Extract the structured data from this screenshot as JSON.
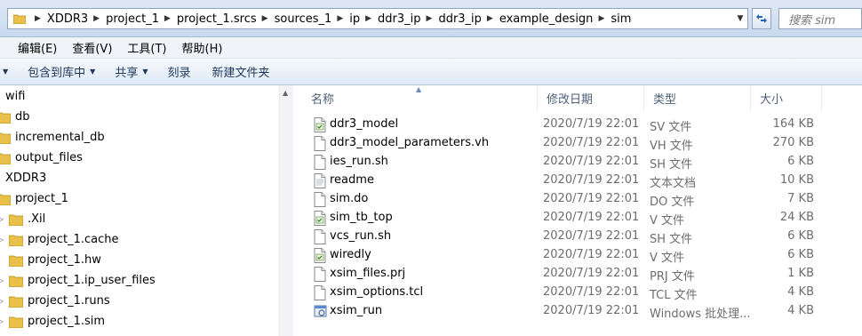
{
  "address": {
    "crumbs": [
      "XDDR3",
      "project_1",
      "project_1.srcs",
      "sources_1",
      "ip",
      "ddr3_ip",
      "ddr3_ip",
      "example_design",
      "sim"
    ],
    "search_placeholder": "搜索 sim"
  },
  "menu": {
    "items": [
      "编辑(E)",
      "查看(V)",
      "工具(T)",
      "帮助(H)"
    ]
  },
  "toolbar": {
    "include_library": "包含到库中",
    "share": "共享",
    "burn": "刻录",
    "new_folder": "新建文件夹"
  },
  "nav": {
    "items": [
      "wifi",
      "db",
      "incremental_db",
      "output_files",
      "XDDR3",
      "project_1",
      ".Xil",
      "project_1.cache",
      "project_1.hw",
      "project_1.ip_user_files",
      "project_1.runs",
      "project_1.sim"
    ]
  },
  "columns": {
    "name": "名称",
    "date": "修改日期",
    "type": "类型",
    "size": "大小"
  },
  "files": [
    {
      "name": "ddr3_model",
      "date": "2020/7/19 22:01",
      "type": "SV 文件",
      "size": "164 KB",
      "icon": "verilog-file-icon"
    },
    {
      "name": "ddr3_model_parameters.vh",
      "date": "2020/7/19 22:01",
      "type": "VH 文件",
      "size": "270 KB",
      "icon": "file-icon"
    },
    {
      "name": "ies_run.sh",
      "date": "2020/7/19 22:01",
      "type": "SH 文件",
      "size": "6 KB",
      "icon": "file-icon"
    },
    {
      "name": "readme",
      "date": "2020/7/19 22:01",
      "type": "文本文档",
      "size": "10 KB",
      "icon": "text-file-icon"
    },
    {
      "name": "sim.do",
      "date": "2020/7/19 22:01",
      "type": "DO 文件",
      "size": "7 KB",
      "icon": "file-icon"
    },
    {
      "name": "sim_tb_top",
      "date": "2020/7/19 22:01",
      "type": "V 文件",
      "size": "24 KB",
      "icon": "verilog-file-icon"
    },
    {
      "name": "vcs_run.sh",
      "date": "2020/7/19 22:01",
      "type": "SH 文件",
      "size": "6 KB",
      "icon": "file-icon"
    },
    {
      "name": "wiredly",
      "date": "2020/7/19 22:01",
      "type": "V 文件",
      "size": "6 KB",
      "icon": "verilog-file-icon"
    },
    {
      "name": "xsim_files.prj",
      "date": "2020/7/19 22:01",
      "type": "PRJ 文件",
      "size": "1 KB",
      "icon": "file-icon"
    },
    {
      "name": "xsim_options.tcl",
      "date": "2020/7/19 22:01",
      "type": "TCL 文件",
      "size": "4 KB",
      "icon": "file-icon"
    },
    {
      "name": "xsim_run",
      "date": "2020/7/19 22:01",
      "type": "Windows 批处理...",
      "size": "4 KB",
      "icon": "batch-file-icon"
    }
  ]
}
